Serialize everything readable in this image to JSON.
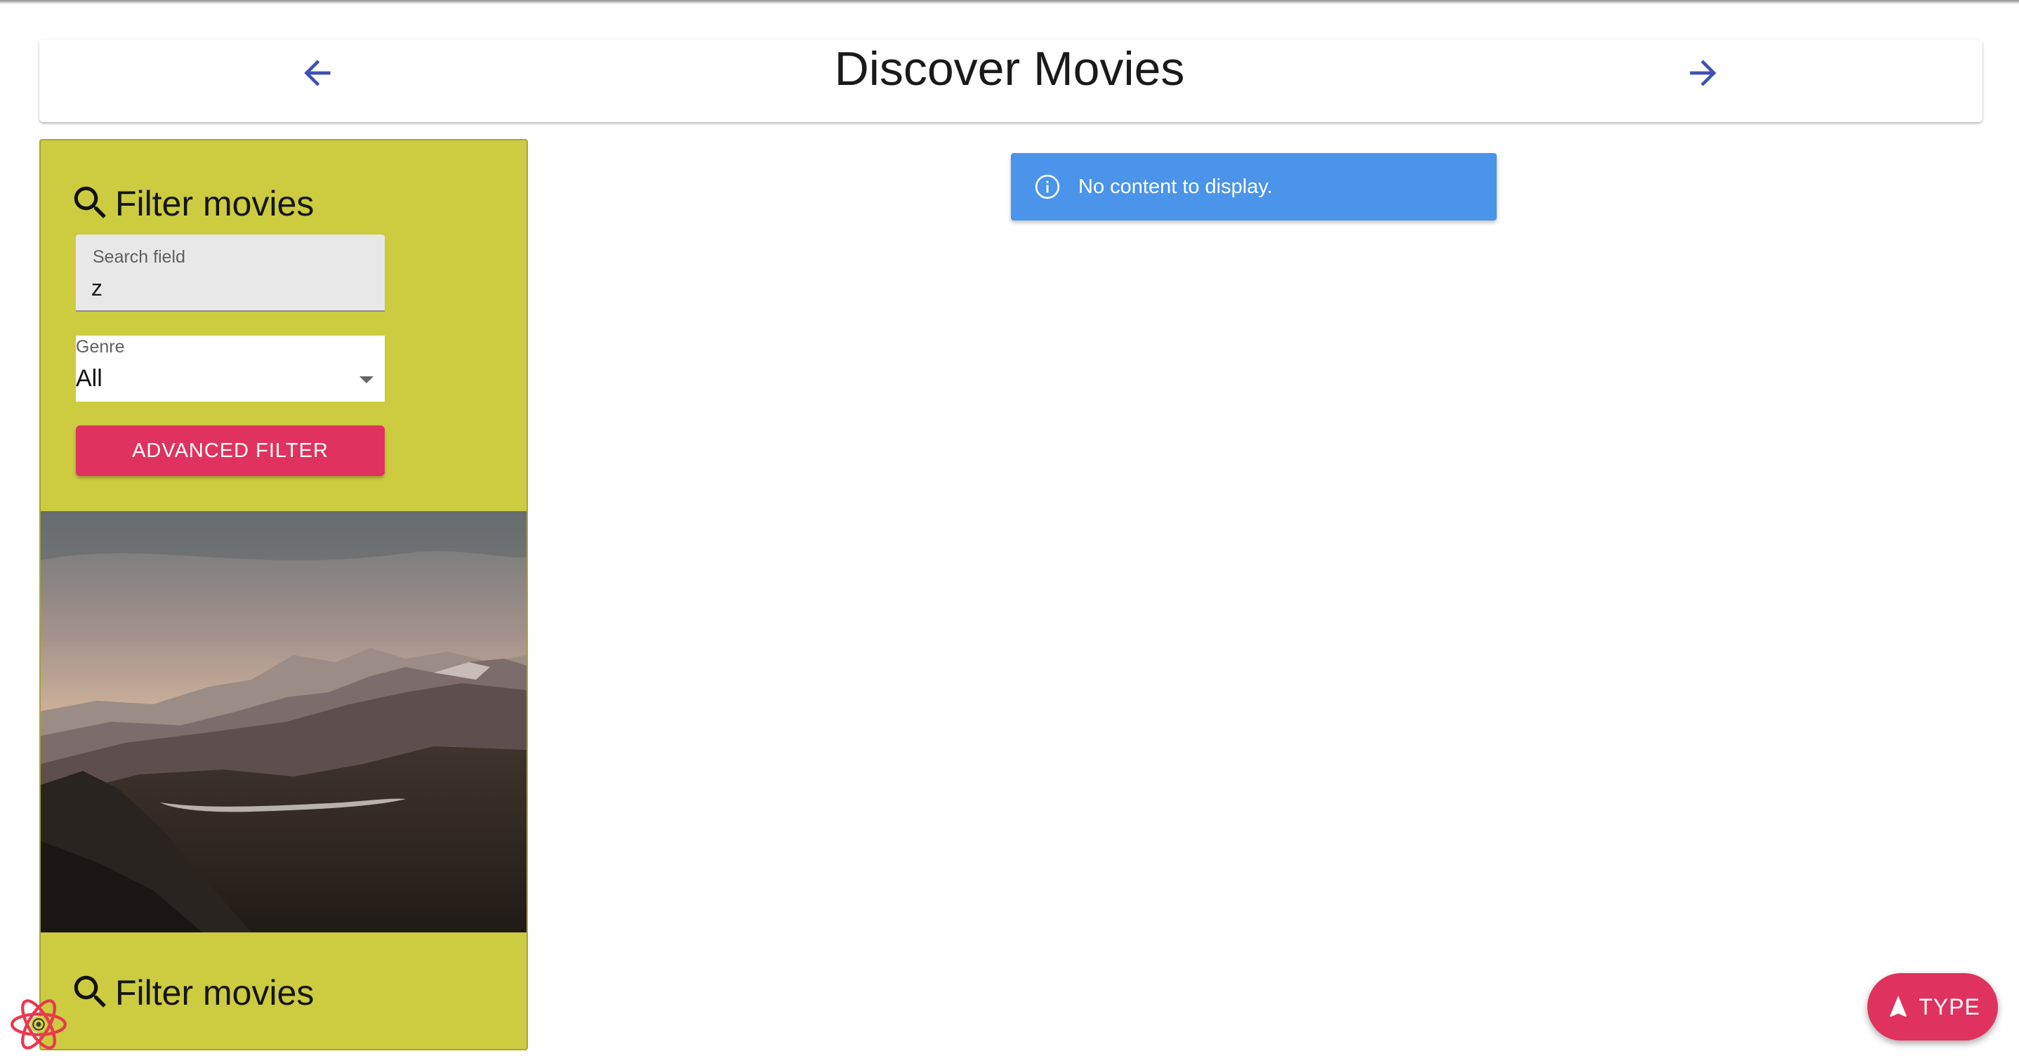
{
  "header": {
    "title": "Discover Movies"
  },
  "filter_panel": {
    "title": "Filter movies",
    "search": {
      "label": "Search field",
      "value": "z"
    },
    "genre": {
      "label": "Genre",
      "selected": "All"
    },
    "advanced_button_label": "ADVANCED FILTER",
    "footer_title": "Filter movies"
  },
  "alert": {
    "message": "No content to display."
  },
  "fab": {
    "label": "TYPE"
  },
  "colors": {
    "panel_background": "#cdcb40",
    "accent_button": "#e0325e",
    "alert_info": "#4a94ea",
    "nav_arrow": "#3f51b5"
  },
  "icons": {
    "back": "arrow-back-icon",
    "forward": "arrow-forward-icon",
    "search": "search-icon",
    "info": "info-icon",
    "dropdown": "chevron-down-icon",
    "fab": "navigation-icon",
    "devtools": "react-logo-icon"
  }
}
